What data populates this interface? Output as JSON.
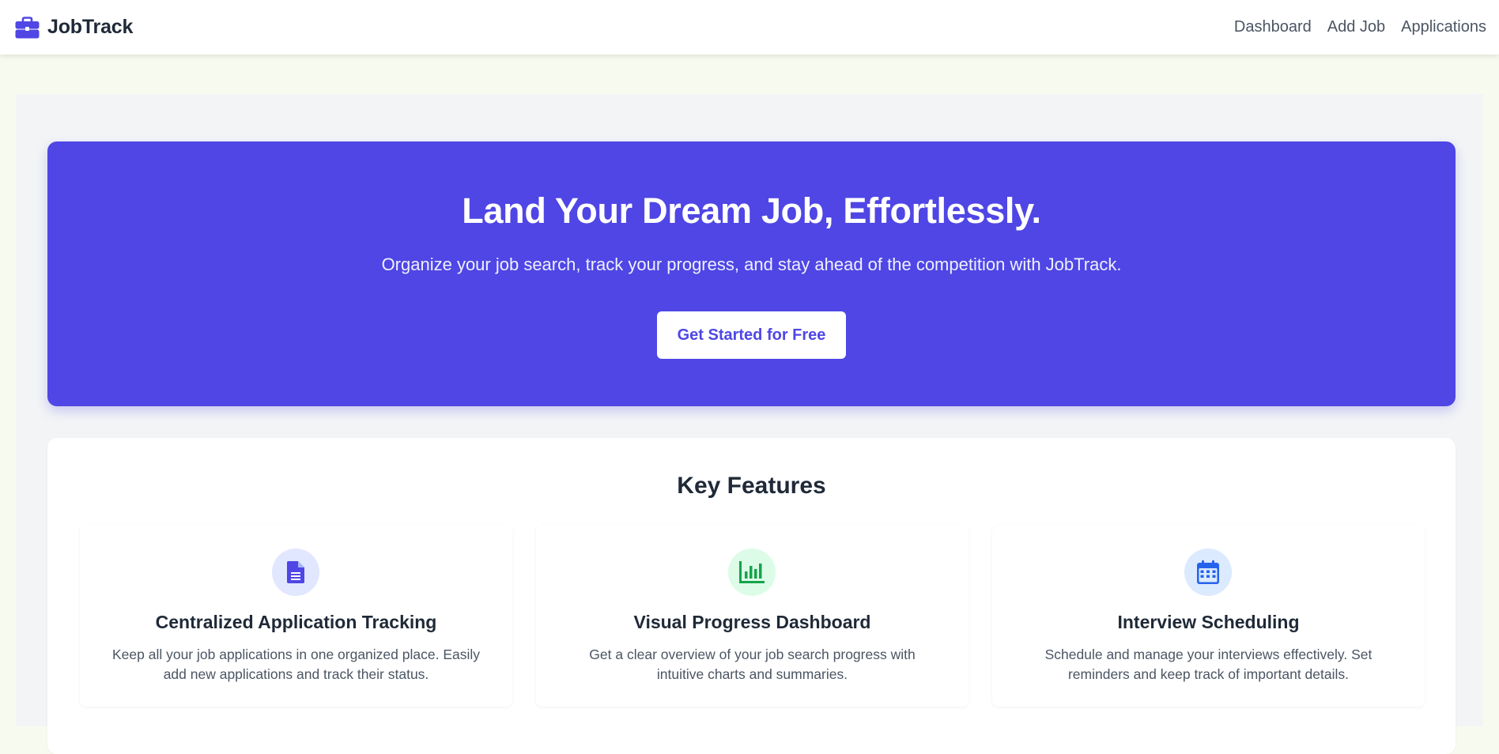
{
  "nav": {
    "brand": "JobTrack",
    "brand_icon": "briefcase-icon",
    "links": [
      "Dashboard",
      "Add Job",
      "Applications"
    ]
  },
  "hero": {
    "title": "Land Your Dream Job, Effortlessly.",
    "subtitle": "Organize your job search, track your progress, and stay ahead of the competition with JobTrack.",
    "cta": "Get Started for Free"
  },
  "features": {
    "title": "Key Features",
    "items": [
      {
        "icon": "document-icon",
        "icon_color": "#4f46e5",
        "icon_bg": "#e0e7ff",
        "title": "Centralized Application Tracking",
        "description": "Keep all your job applications in one organized place. Easily add new applications and track their status."
      },
      {
        "icon": "chart-icon",
        "icon_color": "#16a34a",
        "icon_bg": "#dcfce7",
        "title": "Visual Progress Dashboard",
        "description": "Get a clear overview of your job search progress with intuitive charts and summaries."
      },
      {
        "icon": "calendar-icon",
        "icon_color": "#2563eb",
        "icon_bg": "#dbeafe",
        "title": "Interview Scheduling",
        "description": "Schedule and manage your interviews effectively. Set reminders and keep track of important details."
      }
    ]
  },
  "colors": {
    "primary": "#4f46e5",
    "page_bg": "#f7faee",
    "panel_bg": "#f2f4f6"
  }
}
